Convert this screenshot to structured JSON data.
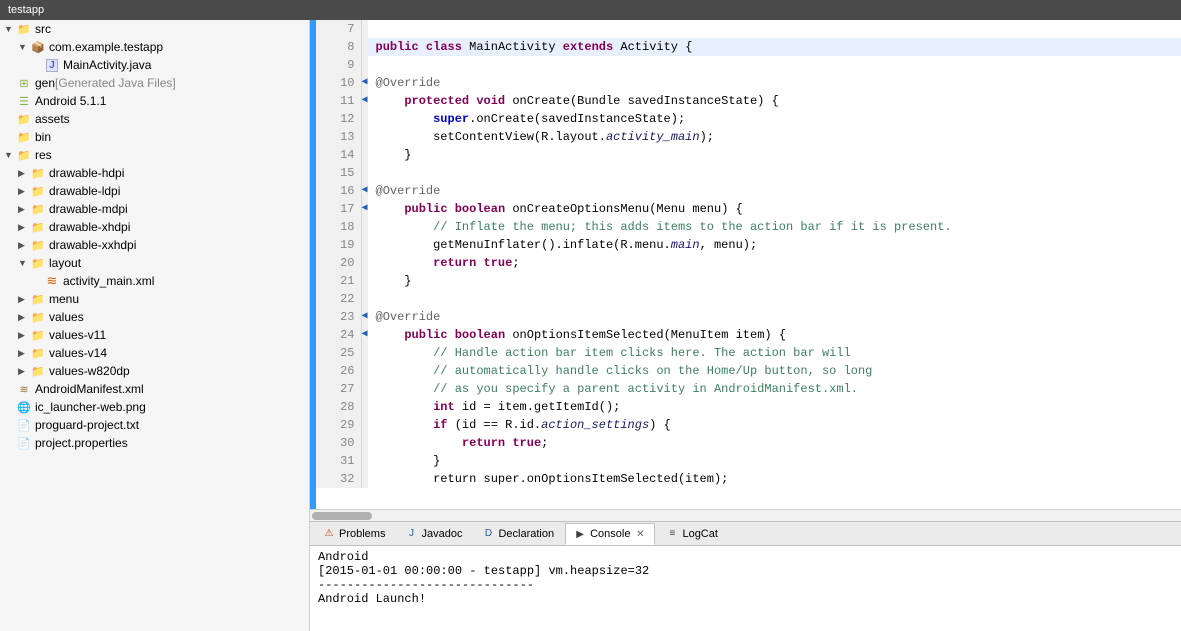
{
  "titleBar": {
    "label": "testapp"
  },
  "sidebar": {
    "items": [
      {
        "id": "src",
        "label": "src",
        "indent": 0,
        "arrow": "▼",
        "iconType": "folder-src",
        "expanded": true
      },
      {
        "id": "com-example",
        "label": "com.example.testapp",
        "indent": 1,
        "arrow": "▼",
        "iconType": "package",
        "expanded": true
      },
      {
        "id": "mainactivity",
        "label": "MainActivity.java",
        "indent": 2,
        "arrow": "",
        "iconType": "java",
        "expanded": false
      },
      {
        "id": "gen",
        "label": "gen",
        "indent": 0,
        "arrow": "",
        "iconType": "gen",
        "suffix": "[Generated Java Files]",
        "expanded": false
      },
      {
        "id": "android511",
        "label": "Android 5.1.1",
        "indent": 0,
        "arrow": "",
        "iconType": "android",
        "expanded": false
      },
      {
        "id": "assets",
        "label": "assets",
        "indent": 0,
        "arrow": "",
        "iconType": "folder",
        "expanded": false
      },
      {
        "id": "bin",
        "label": "bin",
        "indent": 0,
        "arrow": "",
        "iconType": "folder",
        "expanded": false
      },
      {
        "id": "res",
        "label": "res",
        "indent": 0,
        "arrow": "▼",
        "iconType": "res",
        "expanded": true
      },
      {
        "id": "drawable-hdpi",
        "label": "drawable-hdpi",
        "indent": 1,
        "arrow": "▶",
        "iconType": "drawable",
        "expanded": false
      },
      {
        "id": "drawable-ldpi",
        "label": "drawable-ldpi",
        "indent": 1,
        "arrow": "▶",
        "iconType": "drawable",
        "expanded": false
      },
      {
        "id": "drawable-mdpi",
        "label": "drawable-mdpi",
        "indent": 1,
        "arrow": "▶",
        "iconType": "drawable",
        "expanded": false
      },
      {
        "id": "drawable-xhdpi",
        "label": "drawable-xhdpi",
        "indent": 1,
        "arrow": "▶",
        "iconType": "drawable",
        "expanded": false
      },
      {
        "id": "drawable-xxhdpi",
        "label": "drawable-xxhdpi",
        "indent": 1,
        "arrow": "▶",
        "iconType": "drawable",
        "expanded": false
      },
      {
        "id": "layout",
        "label": "layout",
        "indent": 1,
        "arrow": "▼",
        "iconType": "layout",
        "expanded": true
      },
      {
        "id": "activity-main-xml",
        "label": "activity_main.xml",
        "indent": 2,
        "arrow": "",
        "iconType": "xml",
        "expanded": false
      },
      {
        "id": "menu",
        "label": "menu",
        "indent": 1,
        "arrow": "▶",
        "iconType": "folder",
        "expanded": false
      },
      {
        "id": "values",
        "label": "values",
        "indent": 1,
        "arrow": "▶",
        "iconType": "folder",
        "expanded": false
      },
      {
        "id": "values-v11",
        "label": "values-v11",
        "indent": 1,
        "arrow": "▶",
        "iconType": "folder",
        "expanded": false
      },
      {
        "id": "values-v14",
        "label": "values-v14",
        "indent": 1,
        "arrow": "▶",
        "iconType": "folder",
        "expanded": false
      },
      {
        "id": "values-w820dp",
        "label": "values-w820dp",
        "indent": 1,
        "arrow": "▶",
        "iconType": "folder",
        "expanded": false
      },
      {
        "id": "androidmanifest",
        "label": "AndroidManifest.xml",
        "indent": 0,
        "arrow": "",
        "iconType": "manifest",
        "expanded": false
      },
      {
        "id": "ic-launcher",
        "label": "ic_launcher-web.png",
        "indent": 0,
        "arrow": "",
        "iconType": "png",
        "expanded": false
      },
      {
        "id": "proguard",
        "label": "proguard-project.txt",
        "indent": 0,
        "arrow": "",
        "iconType": "txt",
        "expanded": false
      },
      {
        "id": "project-props",
        "label": "project.properties",
        "indent": 0,
        "arrow": "",
        "iconType": "txt",
        "expanded": false
      }
    ]
  },
  "codeLines": [
    {
      "num": 7,
      "content": "",
      "highlight": false,
      "override": false
    },
    {
      "num": 8,
      "content": "__KW_public__ __KW_class__ MainActivity __KW_extends__ Activity {",
      "highlight": true,
      "override": false
    },
    {
      "num": 9,
      "content": "",
      "highlight": false,
      "override": false
    },
    {
      "num": 10,
      "content": "    @Override",
      "highlight": false,
      "override": true
    },
    {
      "num": 11,
      "content": "    __KW_protected__ __KW_void__ onCreate(Bundle savedInstanceState) {",
      "highlight": false,
      "override": true
    },
    {
      "num": 12,
      "content": "        __KW_super__.onCreate(savedInstanceState);",
      "highlight": false,
      "override": false
    },
    {
      "num": 13,
      "content": "        setContentView(R.layout.__ITALIC__activity_main__);",
      "highlight": false,
      "override": false
    },
    {
      "num": 14,
      "content": "    }",
      "highlight": false,
      "override": false
    },
    {
      "num": 15,
      "content": "",
      "highlight": false,
      "override": false
    },
    {
      "num": 16,
      "content": "    @Override",
      "highlight": false,
      "override": true
    },
    {
      "num": 17,
      "content": "    __KW_public__ __KW_boolean__ onCreateOptionsMenu(Menu menu) {",
      "highlight": false,
      "override": true
    },
    {
      "num": 18,
      "content": "        // Inflate the menu; this adds items to the action bar if it is present.",
      "highlight": false,
      "override": false,
      "isComment": true
    },
    {
      "num": 19,
      "content": "        getMenuInflater().inflate(R.menu.__ITALIC__main__, menu);",
      "highlight": false,
      "override": false
    },
    {
      "num": 20,
      "content": "        __KW_return__ __KW_true__;",
      "highlight": false,
      "override": false
    },
    {
      "num": 21,
      "content": "    }",
      "highlight": false,
      "override": false
    },
    {
      "num": 22,
      "content": "",
      "highlight": false,
      "override": false
    },
    {
      "num": 23,
      "content": "    @Override",
      "highlight": false,
      "override": true
    },
    {
      "num": 24,
      "content": "    __KW_public__ __KW_boolean__ onOptionsItemSelected(MenuItem item) {",
      "highlight": false,
      "override": true
    },
    {
      "num": 25,
      "content": "        // Handle action bar item clicks here. The action bar will",
      "highlight": false,
      "override": false,
      "isComment": true
    },
    {
      "num": 26,
      "content": "        // automatically handle clicks on the Home/Up button, so long",
      "highlight": false,
      "override": false,
      "isComment": true
    },
    {
      "num": 27,
      "content": "        // as you specify a parent activity in AndroidManifest.xml.",
      "highlight": false,
      "override": false,
      "isComment": true
    },
    {
      "num": 28,
      "content": "        __KW_int__ id = item.getItemId();",
      "highlight": false,
      "override": false
    },
    {
      "num": 29,
      "content": "        __KW_if__ (id == R.id.__ITALIC__action_settings__) {",
      "highlight": false,
      "override": false
    },
    {
      "num": 30,
      "content": "            __KW_return__ __KW_true__;",
      "highlight": false,
      "override": false
    },
    {
      "num": 31,
      "content": "        }",
      "highlight": false,
      "override": false
    },
    {
      "num": 32,
      "content": "        return super.onOptionsItemSelected(item);",
      "highlight": false,
      "override": false
    }
  ],
  "bottomPanel": {
    "tabs": [
      {
        "id": "problems",
        "label": "Problems",
        "iconColor": "#c04000",
        "active": false,
        "hasClose": false
      },
      {
        "id": "javadoc",
        "label": "Javadoc",
        "iconColor": "#2060a0",
        "active": false,
        "hasClose": false
      },
      {
        "id": "declaration",
        "label": "Declaration",
        "iconColor": "#2060a0",
        "active": false,
        "hasClose": false
      },
      {
        "id": "console",
        "label": "Console",
        "iconColor": "#404040",
        "active": true,
        "hasClose": true
      },
      {
        "id": "logcat",
        "label": "LogCat",
        "iconColor": "#404040",
        "active": false,
        "hasClose": false
      }
    ],
    "consoleLines": [
      "Android",
      "[2015-01-01 00:00:00 - testapp] vm.heapsize=32",
      "------------------------------",
      "Android Launch!"
    ]
  }
}
